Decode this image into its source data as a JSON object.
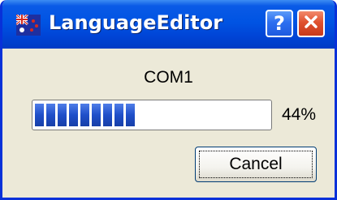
{
  "window": {
    "title": "LanguageEditor",
    "help_label": "?",
    "close_label": "✕"
  },
  "dialog": {
    "port_label": "COM1",
    "progress": {
      "value": 0.44,
      "percent_label": "44%",
      "color": "#1F4FC9"
    },
    "cancel_label": "Cancel"
  },
  "icons": {
    "app": "flag-icon",
    "help": "help-icon",
    "close": "close-icon"
  },
  "colors": {
    "titlebar": "#0054E3",
    "face": "#ECE9D8",
    "close_button": "#E0512F"
  }
}
